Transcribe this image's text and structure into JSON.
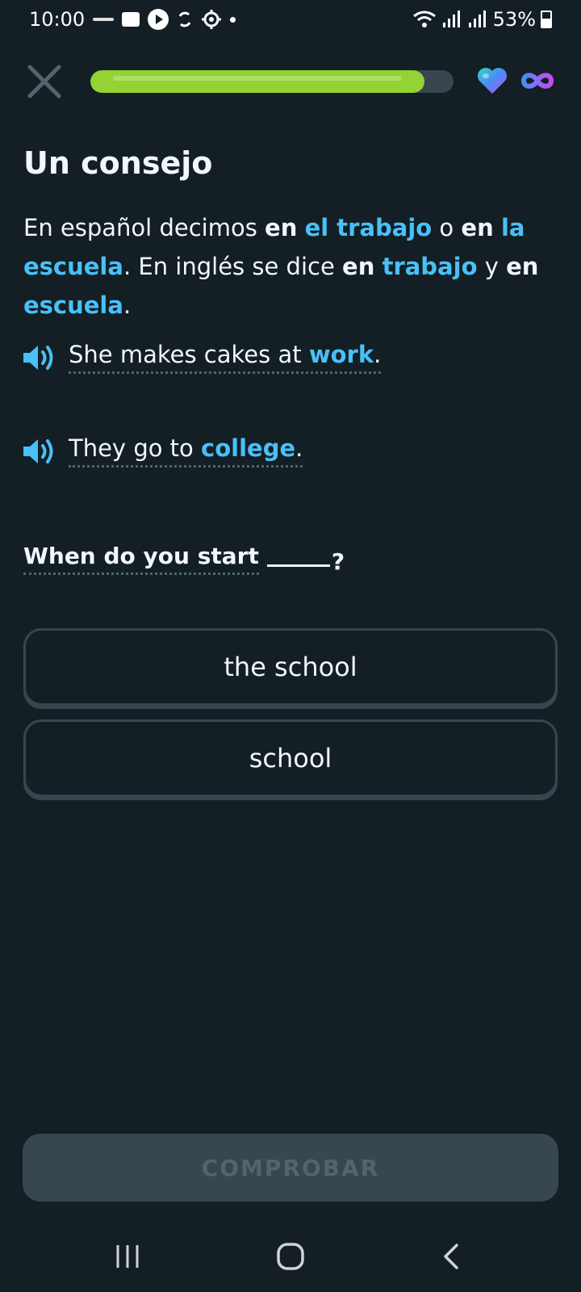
{
  "status_bar": {
    "time": "10:00",
    "battery": "53%"
  },
  "header": {
    "progress_percent": 92,
    "hearts": "infinite"
  },
  "tip": {
    "title": "Un consejo",
    "segments": [
      {
        "text": "En español decimos ",
        "style": "normal"
      },
      {
        "text": "en",
        "style": "bold"
      },
      {
        "text": " ",
        "style": "normal"
      },
      {
        "text": "el trabajo",
        "style": "highlight"
      },
      {
        "text": " o ",
        "style": "normal"
      },
      {
        "text": "en",
        "style": "bold"
      },
      {
        "text": " ",
        "style": "normal"
      },
      {
        "text": "la escuela",
        "style": "highlight"
      },
      {
        "text": ". En inglés se dice ",
        "style": "normal"
      },
      {
        "text": "en",
        "style": "bold"
      },
      {
        "text": " ",
        "style": "normal"
      },
      {
        "text": "trabajo",
        "style": "highlight"
      },
      {
        "text": " y ",
        "style": "normal"
      },
      {
        "text": "en",
        "style": "bold"
      },
      {
        "text": " ",
        "style": "normal"
      },
      {
        "text": "escuela",
        "style": "highlight"
      },
      {
        "text": ".",
        "style": "normal"
      }
    ]
  },
  "examples": [
    {
      "pre": "She makes cakes at ",
      "highlight": "work",
      "post": "."
    },
    {
      "pre": "They go to ",
      "highlight": "college",
      "post": "."
    }
  ],
  "question": {
    "text": "When do you start",
    "end": "?"
  },
  "options": [
    {
      "label": "the school"
    },
    {
      "label": "school"
    }
  ],
  "check_button": {
    "label": "COMPROBAR"
  },
  "colors": {
    "background": "#131f24",
    "accent_blue": "#49c0f8",
    "progress_green": "#93d333",
    "border": "#37464f"
  }
}
